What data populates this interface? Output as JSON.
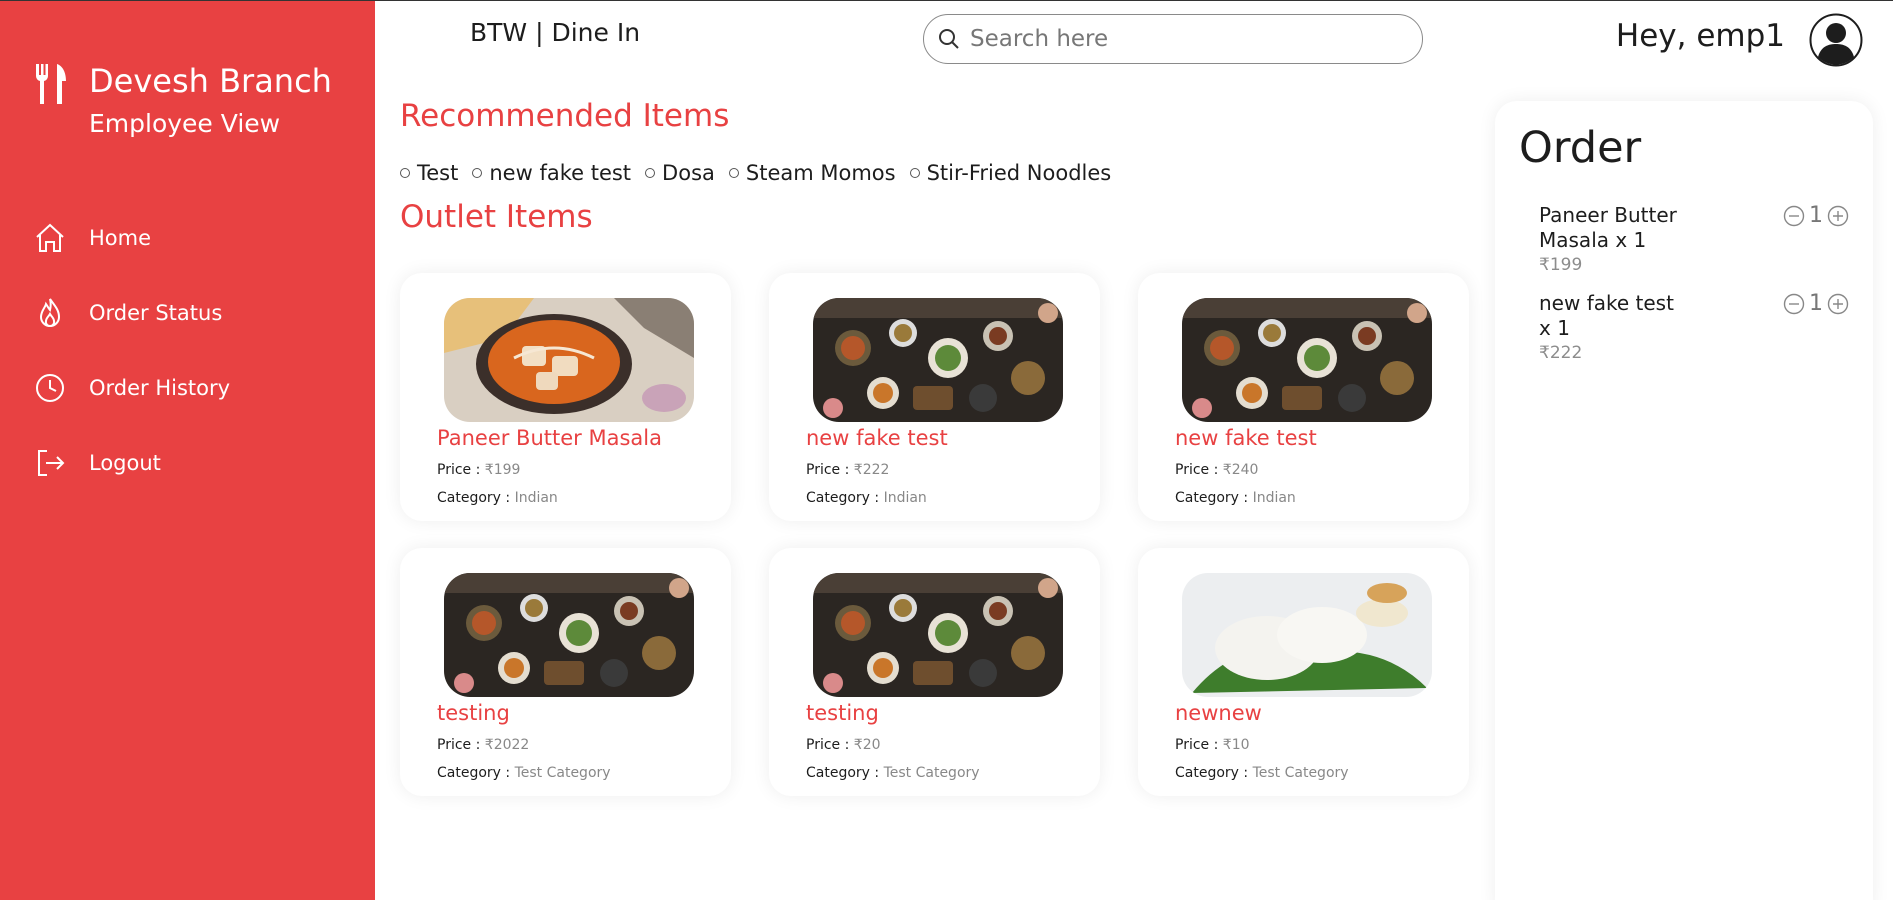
{
  "sidebar": {
    "brand_title": "Devesh Branch",
    "brand_subtitle": "Employee View",
    "nav": [
      {
        "label": "Home"
      },
      {
        "label": "Order Status"
      },
      {
        "label": "Order History"
      },
      {
        "label": "Logout"
      }
    ]
  },
  "header": {
    "title": "BTW | Dine In",
    "search_placeholder": "Search here",
    "greeting": "Hey, emp1"
  },
  "recommended": {
    "title": "Recommended Items",
    "items": [
      "Test",
      "new fake test",
      "Dosa",
      "Steam Momos",
      "Stir-Fried Noodles"
    ]
  },
  "outlet": {
    "title": "Outlet Items",
    "price_label": "Price : ",
    "category_label": "Category : ",
    "items": [
      {
        "name": "Paneer Butter Masala",
        "price": "₹199",
        "category": "Indian",
        "image": "curry"
      },
      {
        "name": "new fake test",
        "price": "₹222",
        "category": "Indian",
        "image": "table-spread"
      },
      {
        "name": "new fake test",
        "price": "₹240",
        "category": "Indian",
        "image": "table-spread"
      },
      {
        "name": "testing",
        "price": "₹2022",
        "category": "Test Category",
        "image": "table-spread"
      },
      {
        "name": "testing",
        "price": "₹20",
        "category": "Test Category",
        "image": "table-spread"
      },
      {
        "name": "newnew",
        "price": "₹10",
        "category": "Test Category",
        "image": "idli"
      }
    ]
  },
  "order": {
    "title": "Order",
    "items": [
      {
        "name": "Paneer Butter Masala x 1",
        "price": "₹199",
        "qty": "1"
      },
      {
        "name": "new fake test x 1",
        "price": "₹222",
        "qty": "1"
      }
    ]
  },
  "colors": {
    "accent": "#e84142",
    "sidebar_bg": "#e84142",
    "muted_text": "#888888"
  }
}
